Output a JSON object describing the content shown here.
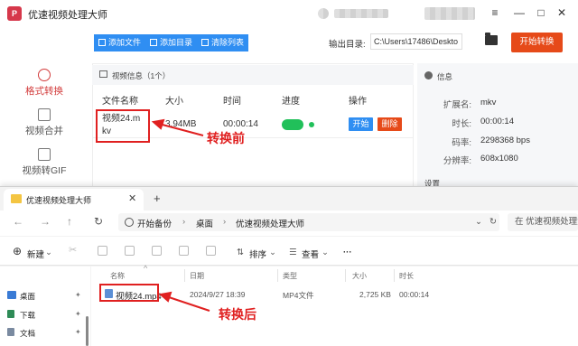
{
  "app": {
    "title": "优速视频处理大师",
    "logo_glyph": "P"
  },
  "window_controls": {
    "menu": "≡",
    "minimize": "—",
    "maximize": "□",
    "close": "✕"
  },
  "nav": {
    "items": [
      {
        "label": "格式转换",
        "active": true
      },
      {
        "label": "视频合并",
        "active": false
      },
      {
        "label": "视频转GIF",
        "active": false
      }
    ]
  },
  "toolbar": {
    "add_file": "添加文件",
    "add_folder": "添加目录",
    "clear_list": "清除列表",
    "output_label": "输出目录:",
    "output_path": "C:\\Users\\17486\\Deskto",
    "convert_all": "开始转换"
  },
  "file_panel": {
    "header": "视频信息（1个）",
    "columns": [
      "文件名称",
      "大小",
      "时间",
      "进度",
      "操作"
    ],
    "rows": [
      {
        "name": "视频24.mkv",
        "size": "3.94MB",
        "duration": "00:00:14",
        "start": "开始",
        "delete": "删除"
      }
    ]
  },
  "info_panel": {
    "header": "信息",
    "fields": [
      {
        "key": "扩展名:",
        "value": "mkv"
      },
      {
        "key": "时长:",
        "value": "00:00:14"
      },
      {
        "key": "码率:",
        "value": "2298368 bps"
      },
      {
        "key": "分辨率:",
        "value": "608x1080"
      }
    ],
    "settings_header": "设置"
  },
  "annotations": {
    "before": "转换前",
    "after": "转换后",
    "color": "#e02020"
  },
  "explorer": {
    "tab_title": "优速视频处理大师",
    "new_tab": "+",
    "close_tab": "✕",
    "breadcrumbs": [
      "开始备份",
      "桌面",
      "优速视频处理大师"
    ],
    "search_placeholder": "在 优速视频处理大师 中",
    "commands": {
      "new": "新建",
      "sort": "排序",
      "view": "查看",
      "more": "···"
    },
    "sidebar": [
      {
        "label": "桌面",
        "color": "#3a7bd5"
      },
      {
        "label": "下载",
        "color": "#2e8b57"
      },
      {
        "label": "文档",
        "color": "#7a8aa0"
      }
    ],
    "columns": [
      "名称",
      "日期",
      "类型",
      "大小",
      "时长"
    ],
    "files": [
      {
        "name": "视频24.mp4",
        "date": "2024/9/27 18:39",
        "type": "MP4文件",
        "size": "2,725 KB",
        "duration": "00:00:14"
      }
    ]
  },
  "colors": {
    "accent_blue": "#2f8ef2",
    "accent_orange": "#e64a19",
    "nav_active": "#d23b3b",
    "progress_green": "#21c05a"
  }
}
